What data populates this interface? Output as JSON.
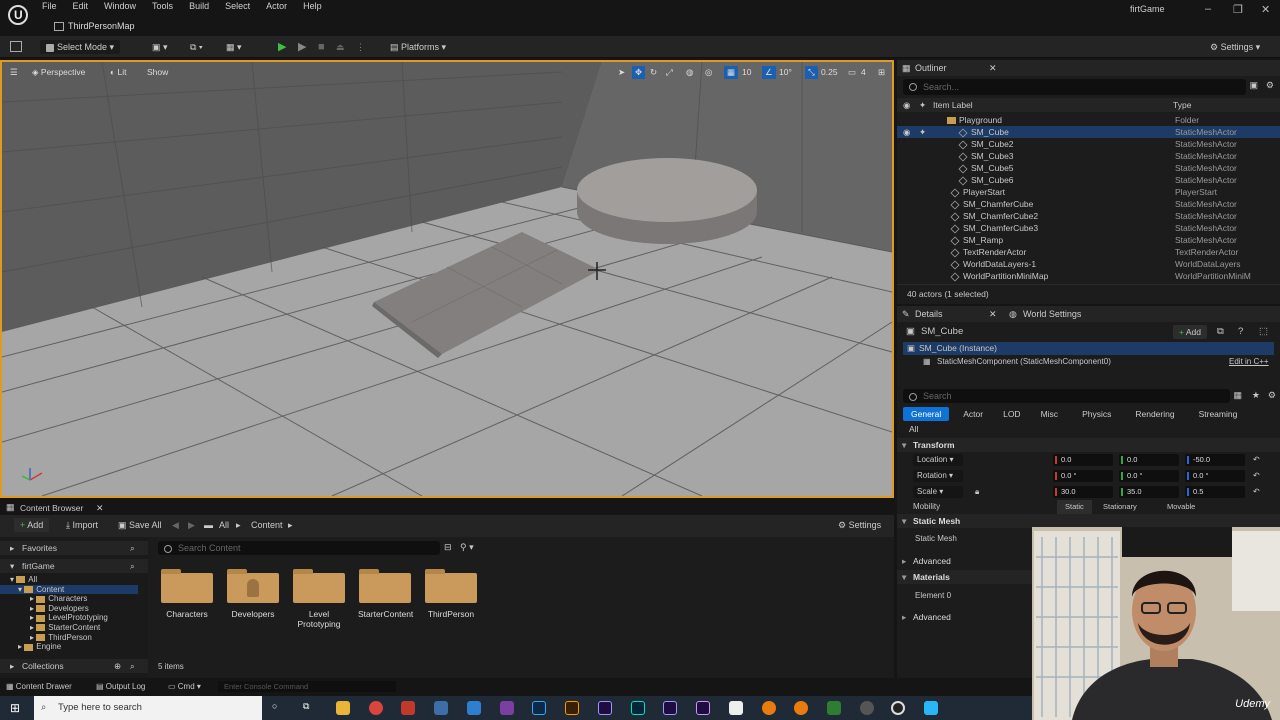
{
  "app": {
    "menu": [
      "File",
      "Edit",
      "Window",
      "Tools",
      "Build",
      "Select",
      "Actor",
      "Help"
    ],
    "map_tab": "ThirdPersonMap",
    "project_name": "firtGame"
  },
  "toolbar": {
    "select_mode": "Select Mode",
    "platforms": "Platforms",
    "settings": "Settings"
  },
  "viewport": {
    "perspective": "Perspective",
    "lit": "Lit",
    "show": "Show",
    "grid_snap": "10",
    "rot_snap": "10°",
    "scale_snap": "0.25",
    "cam_speed": "4"
  },
  "outliner": {
    "title": "Outliner",
    "search_placeholder": "Search...",
    "col_label": "Item Label",
    "col_type": "Type",
    "rows": [
      {
        "label": "Playground",
        "type": "Folder",
        "kind": "folder"
      },
      {
        "label": "SM_Cube",
        "type": "StaticMeshActor",
        "kind": "mesh"
      },
      {
        "label": "SM_Cube2",
        "type": "StaticMeshActor",
        "kind": "mesh"
      },
      {
        "label": "SM_Cube3",
        "type": "StaticMeshActor",
        "kind": "mesh"
      },
      {
        "label": "SM_Cube5",
        "type": "StaticMeshActor",
        "kind": "mesh"
      },
      {
        "label": "SM_Cube6",
        "type": "StaticMeshActor",
        "kind": "mesh"
      },
      {
        "label": "PlayerStart",
        "type": "PlayerStart",
        "kind": "mesh"
      },
      {
        "label": "SM_ChamferCube",
        "type": "StaticMeshActor",
        "kind": "mesh"
      },
      {
        "label": "SM_ChamferCube2",
        "type": "StaticMeshActor",
        "kind": "mesh"
      },
      {
        "label": "SM_ChamferCube3",
        "type": "StaticMeshActor",
        "kind": "mesh"
      },
      {
        "label": "SM_Ramp",
        "type": "StaticMeshActor",
        "kind": "mesh"
      },
      {
        "label": "TextRenderActor",
        "type": "TextRenderActor",
        "kind": "mesh"
      },
      {
        "label": "WorldDataLayers-1",
        "type": "WorldDataLayers",
        "kind": "mesh"
      },
      {
        "label": "WorldPartitionMiniMap",
        "type": "WorldPartitionMiniM",
        "kind": "mesh"
      }
    ],
    "status": "40 actors (1 selected)"
  },
  "details": {
    "tab_details": "Details",
    "tab_world": "World Settings",
    "actor_name": "SM_Cube",
    "add": "Add",
    "instance": "SM_Cube (Instance)",
    "component": "StaticMeshComponent (StaticMeshComponent0)",
    "edit_cpp": "Edit in C++",
    "search_placeholder": "Search",
    "filters": [
      "General",
      "Actor",
      "LOD",
      "Misc",
      "Physics",
      "Rendering",
      "Streaming"
    ],
    "filter_all": "All",
    "transform": "Transform",
    "location_label": "Location",
    "location": [
      "0.0",
      "0.0",
      "-50.0"
    ],
    "rotation_label": "Rotation",
    "rotation": [
      "0.0 °",
      "0.0 °",
      "0.0 °"
    ],
    "scale_label": "Scale",
    "scale": [
      "30.0",
      "35.0",
      "0.5"
    ],
    "mobility_label": "Mobility",
    "mobility": [
      "Static",
      "Stationary",
      "Movable"
    ],
    "static_mesh_section": "Static Mesh",
    "static_mesh_label": "Static Mesh",
    "advanced": "Advanced",
    "materials": "Materials",
    "element0": "Element 0",
    "advanced2": "Advanced"
  },
  "content_browser": {
    "tab": "Content Browser",
    "add": "Add",
    "import": "Import",
    "save_all": "Save All",
    "crumb_all": "All",
    "crumb_content": "Content",
    "settings": "Settings",
    "favorites": "Favorites",
    "project": "firtGame",
    "tree": [
      "All",
      "Content",
      "Characters",
      "Developers",
      "LevelPrototyping",
      "StarterContent",
      "ThirdPerson",
      "Engine"
    ],
    "collections": "Collections",
    "search_placeholder": "Search Content",
    "folders": [
      "Characters",
      "Developers",
      "Level Prototyping",
      "StarterContent",
      "ThirdPerson"
    ],
    "items_count": "5 items"
  },
  "statusbar": {
    "content_drawer": "Content Drawer",
    "output_log": "Output Log",
    "cmd": "Cmd",
    "console_placeholder": "Enter Console Command"
  },
  "taskbar": {
    "search_placeholder": "Type here to search"
  },
  "watermark": "Udemy"
}
